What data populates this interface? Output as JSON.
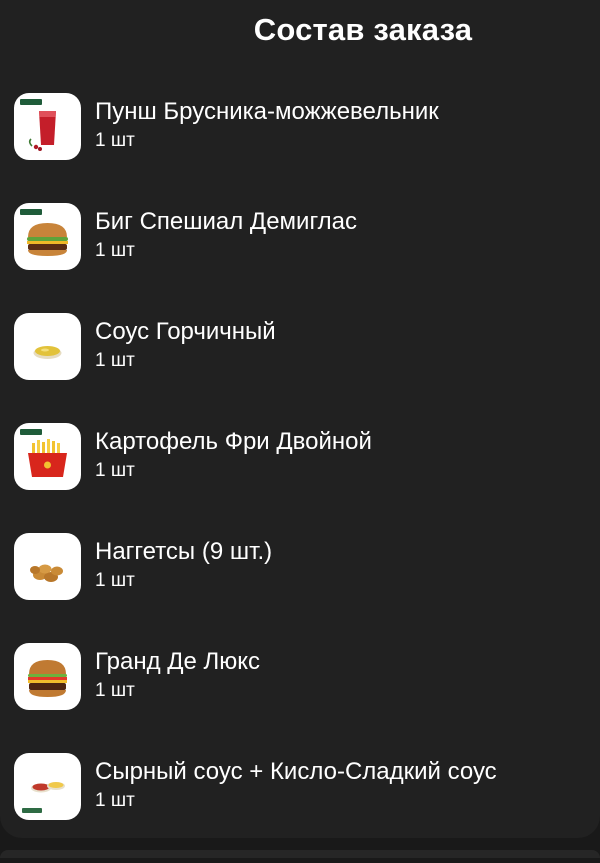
{
  "header": {
    "title": "Состав заказа"
  },
  "items": [
    {
      "name": "Пунш Брусника-можжевельник",
      "qty": "1 шт",
      "icon": "red-drink-icon"
    },
    {
      "name": "Биг Спешиал Демиглас",
      "qty": "1 шт",
      "icon": "burger-icon"
    },
    {
      "name": "Соус Горчичный",
      "qty": "1 шт",
      "icon": "mustard-sauce-icon"
    },
    {
      "name": "Картофель Фри Двойной",
      "qty": "1 шт",
      "icon": "fries-icon"
    },
    {
      "name": "Наггетсы (9 шт.)",
      "qty": "1 шт",
      "icon": "nuggets-icon"
    },
    {
      "name": "Гранд Де Люкс",
      "qty": "1 шт",
      "icon": "burger-icon"
    },
    {
      "name": "Сырный соус + Кисло-Сладкий соус",
      "qty": "1 шт",
      "icon": "sauces-icon"
    }
  ],
  "colors": {
    "background": "#191919",
    "sheet": "#212121",
    "text": "#ffffff",
    "badge": "#1f5c3a"
  }
}
